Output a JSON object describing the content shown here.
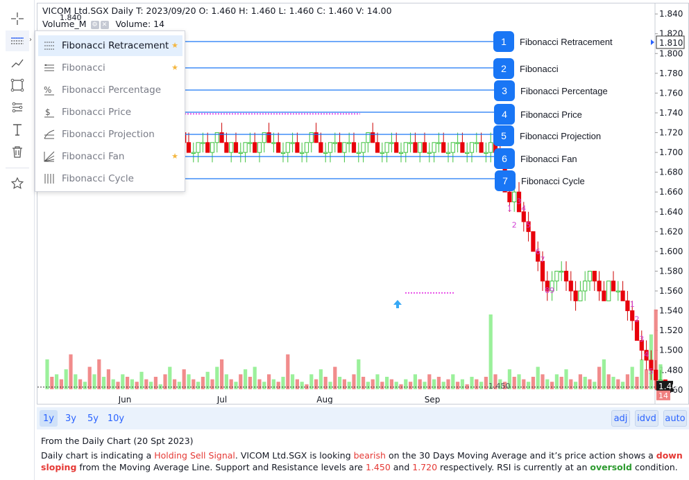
{
  "toolbar": {
    "tools": [
      "crosshair-icon",
      "fibonacci-icon",
      "trendline-icon",
      "rectangle-icon",
      "node-path-icon",
      "text-icon",
      "trash-icon",
      "star-icon"
    ]
  },
  "legend": {
    "symbol_line": "VICOM Ltd.SGX Daily   T: 2023/09/20  O: 1.460  H: 1.460  L: 1.460  C: 1.460  V: 14.00",
    "volume_label": "Volume_M",
    "volume_value": "Volume: 14",
    "high_marker": "1.840"
  },
  "menu": {
    "items": [
      {
        "label": "Fibonacci Retracement",
        "icon": "fibonacci-retracement-icon",
        "starred": true,
        "active": true
      },
      {
        "label": "Fibonacci",
        "icon": "fibonacci-icon",
        "starred": true,
        "active": false
      },
      {
        "label": "Fibonacci Percentage",
        "icon": "fibonacci-percentage-icon",
        "starred": false,
        "active": false
      },
      {
        "label": "Fibonacci Price",
        "icon": "fibonacci-price-icon",
        "starred": false,
        "active": false
      },
      {
        "label": "Fibonacci Projection",
        "icon": "fibonacci-projection-icon",
        "starred": false,
        "active": false
      },
      {
        "label": "Fibonacci Fan",
        "icon": "fibonacci-fan-icon",
        "starred": true,
        "active": false
      },
      {
        "label": "Fibonacci Cycle",
        "icon": "fibonacci-cycle-icon",
        "starred": false,
        "active": false
      }
    ]
  },
  "callouts": [
    {
      "number": "1",
      "label": "Fibonacci Retracement"
    },
    {
      "number": "2",
      "label": "Fibonacci"
    },
    {
      "number": "3",
      "label": "Fibonacci Percentage"
    },
    {
      "number": "4",
      "label": "Fibonacci Price"
    },
    {
      "number": "5",
      "label": "Fibonacci Projection"
    },
    {
      "number": "6",
      "label": "Fibonacci Fan"
    },
    {
      "number": "7",
      "label": "Fibonacci Cycle"
    }
  ],
  "range_buttons": [
    {
      "label": "1y",
      "active": true
    },
    {
      "label": "3y",
      "active": false
    },
    {
      "label": "5y",
      "active": false
    },
    {
      "label": "10y",
      "active": false
    }
  ],
  "right_buttons": [
    "adj",
    "idvd",
    "auto"
  ],
  "analysis": {
    "heading": "From the Daily Chart (20 Spt 2023)",
    "p1": "Daily chart is indicating a ",
    "signal": "Holding Sell Signal",
    "p2": ". VICOM Ltd.SGX is looking ",
    "bearish": "bearish",
    "p3": " on the 30 Days Moving Average and it’s price action shows a ",
    "down_sloping": "down sloping",
    "p4": " from the Moving Average Line. Support and Resistance levels are ",
    "support": "1.450",
    "p5": " and ",
    "resistance": "1.720",
    "p6": " respectively. RSI is currently at an ",
    "oversold": "oversold",
    "p7": " condition."
  },
  "chart_data": {
    "type": "candlestick",
    "y_ticks": [
      "1.840",
      "1.820",
      "1.800",
      "1.780",
      "1.760",
      "1.740",
      "1.720",
      "1.700",
      "1.680",
      "1.660",
      "1.640",
      "1.620",
      "1.600",
      "1.580",
      "1.560",
      "1.540",
      "1.520",
      "1.500",
      "1.480",
      "1.460"
    ],
    "ylim": [
      1.455,
      1.845
    ],
    "x_labels": [
      "Jun",
      "Jul",
      "Aug",
      "Sep"
    ],
    "price_marker": "1.810",
    "last_price": "1.46",
    "volume_badge": "14",
    "support_label": "1.450",
    "colors": {
      "up": "#90ee90",
      "down": "#e8000b",
      "vol_up": "#90ee90",
      "vol_down": "#f08080",
      "fib_line": "#1976f5",
      "count": "#d03fd3"
    },
    "td_counts": [
      {
        "label": "1",
        "day": 98,
        "price": 1.641
      },
      {
        "label": "2",
        "day": 99,
        "price": 1.624
      },
      {
        "label": "3",
        "day": 100,
        "price": 1.648
      },
      {
        "label": "4",
        "day": 101,
        "price": 1.641
      },
      {
        "label": "5",
        "day": 102,
        "price": 1.624
      },
      {
        "label": "6",
        "day": 104,
        "price": 1.597
      },
      {
        "label": "7",
        "day": 105,
        "price": 1.589
      },
      {
        "label": "8",
        "day": 106,
        "price": 1.558
      },
      {
        "label": "9",
        "day": 107,
        "price": 1.558
      },
      {
        "label": "1",
        "day": 124,
        "price": 1.544
      },
      {
        "label": "2",
        "day": 125,
        "price": 1.529
      },
      {
        "label": "3",
        "day": 126,
        "price": 1.509
      },
      {
        "label": "4",
        "day": 127,
        "price": 1.493
      },
      {
        "label": "5",
        "day": 128,
        "price": 1.476
      }
    ],
    "candles": [
      [
        1.72,
        1.74,
        1.71,
        1.73
      ],
      [
        1.73,
        1.74,
        1.72,
        1.72
      ],
      [
        1.72,
        1.73,
        1.71,
        1.72
      ],
      [
        1.72,
        1.73,
        1.71,
        1.71
      ],
      [
        1.71,
        1.72,
        1.7,
        1.72
      ],
      [
        1.72,
        1.73,
        1.71,
        1.72
      ],
      [
        1.72,
        1.73,
        1.71,
        1.71
      ],
      [
        1.71,
        1.72,
        1.7,
        1.71
      ],
      [
        1.71,
        1.72,
        1.7,
        1.72
      ],
      [
        1.72,
        1.73,
        1.71,
        1.71
      ],
      [
        1.71,
        1.72,
        1.7,
        1.71
      ],
      [
        1.71,
        1.72,
        1.7,
        1.7
      ],
      [
        1.7,
        1.71,
        1.69,
        1.71
      ],
      [
        1.71,
        1.72,
        1.7,
        1.72
      ],
      [
        1.72,
        1.73,
        1.71,
        1.71
      ],
      [
        1.71,
        1.72,
        1.7,
        1.7
      ],
      [
        1.7,
        1.71,
        1.69,
        1.71
      ],
      [
        1.71,
        1.72,
        1.7,
        1.72
      ],
      [
        1.72,
        1.73,
        1.71,
        1.71
      ],
      [
        1.71,
        1.72,
        1.7,
        1.7
      ],
      [
        1.7,
        1.71,
        1.69,
        1.7
      ],
      [
        1.7,
        1.71,
        1.69,
        1.71
      ],
      [
        1.71,
        1.72,
        1.7,
        1.72
      ],
      [
        1.72,
        1.73,
        1.71,
        1.71
      ],
      [
        1.71,
        1.72,
        1.7,
        1.71
      ],
      [
        1.71,
        1.72,
        1.7,
        1.7
      ],
      [
        1.7,
        1.71,
        1.69,
        1.7
      ],
      [
        1.7,
        1.72,
        1.69,
        1.71
      ],
      [
        1.71,
        1.72,
        1.7,
        1.72
      ],
      [
        1.72,
        1.73,
        1.71,
        1.71
      ],
      [
        1.71,
        1.72,
        1.7,
        1.7
      ],
      [
        1.7,
        1.71,
        1.69,
        1.7
      ],
      [
        1.7,
        1.71,
        1.69,
        1.71
      ],
      [
        1.71,
        1.72,
        1.7,
        1.71
      ],
      [
        1.71,
        1.72,
        1.7,
        1.7
      ],
      [
        1.7,
        1.71,
        1.69,
        1.71
      ],
      [
        1.71,
        1.72,
        1.7,
        1.72
      ],
      [
        1.72,
        1.73,
        1.71,
        1.71
      ],
      [
        1.71,
        1.72,
        1.7,
        1.7
      ],
      [
        1.7,
        1.71,
        1.69,
        1.71
      ],
      [
        1.71,
        1.72,
        1.7,
        1.7
      ],
      [
        1.7,
        1.71,
        1.69,
        1.7
      ],
      [
        1.7,
        1.71,
        1.69,
        1.71
      ],
      [
        1.71,
        1.72,
        1.7,
        1.71
      ],
      [
        1.71,
        1.72,
        1.7,
        1.7
      ],
      [
        1.7,
        1.71,
        1.69,
        1.71
      ],
      [
        1.71,
        1.72,
        1.7,
        1.72
      ],
      [
        1.72,
        1.73,
        1.71,
        1.71
      ],
      [
        1.71,
        1.72,
        1.7,
        1.71
      ],
      [
        1.71,
        1.72,
        1.7,
        1.7
      ],
      [
        1.7,
        1.71,
        1.69,
        1.7
      ],
      [
        1.7,
        1.71,
        1.69,
        1.71
      ],
      [
        1.71,
        1.72,
        1.7,
        1.71
      ],
      [
        1.71,
        1.72,
        1.7,
        1.7
      ],
      [
        1.7,
        1.71,
        1.69,
        1.7
      ],
      [
        1.7,
        1.71,
        1.69,
        1.71
      ],
      [
        1.71,
        1.72,
        1.7,
        1.72
      ],
      [
        1.72,
        1.73,
        1.71,
        1.71
      ],
      [
        1.71,
        1.72,
        1.7,
        1.7
      ],
      [
        1.7,
        1.71,
        1.69,
        1.7
      ],
      [
        1.7,
        1.71,
        1.69,
        1.71
      ],
      [
        1.71,
        1.72,
        1.7,
        1.71
      ],
      [
        1.71,
        1.72,
        1.7,
        1.7
      ],
      [
        1.7,
        1.71,
        1.69,
        1.71
      ],
      [
        1.71,
        1.72,
        1.7,
        1.71
      ],
      [
        1.71,
        1.72,
        1.7,
        1.7
      ],
      [
        1.7,
        1.71,
        1.69,
        1.7
      ],
      [
        1.7,
        1.71,
        1.69,
        1.71
      ],
      [
        1.71,
        1.72,
        1.7,
        1.72
      ],
      [
        1.72,
        1.73,
        1.71,
        1.71
      ],
      [
        1.71,
        1.72,
        1.7,
        1.7
      ],
      [
        1.7,
        1.71,
        1.69,
        1.7
      ],
      [
        1.7,
        1.71,
        1.69,
        1.71
      ],
      [
        1.71,
        1.72,
        1.7,
        1.71
      ],
      [
        1.71,
        1.72,
        1.7,
        1.7
      ],
      [
        1.7,
        1.71,
        1.69,
        1.7
      ],
      [
        1.7,
        1.71,
        1.69,
        1.71
      ],
      [
        1.71,
        1.72,
        1.7,
        1.71
      ],
      [
        1.71,
        1.72,
        1.7,
        1.7
      ],
      [
        1.7,
        1.71,
        1.69,
        1.71
      ],
      [
        1.71,
        1.72,
        1.7,
        1.7
      ],
      [
        1.7,
        1.71,
        1.69,
        1.7
      ],
      [
        1.7,
        1.71,
        1.69,
        1.71
      ],
      [
        1.71,
        1.72,
        1.7,
        1.71
      ],
      [
        1.71,
        1.72,
        1.7,
        1.7
      ],
      [
        1.7,
        1.71,
        1.69,
        1.7
      ],
      [
        1.7,
        1.71,
        1.69,
        1.71
      ],
      [
        1.71,
        1.72,
        1.7,
        1.71
      ],
      [
        1.71,
        1.72,
        1.7,
        1.7
      ],
      [
        1.7,
        1.71,
        1.69,
        1.7
      ],
      [
        1.7,
        1.71,
        1.69,
        1.71
      ],
      [
        1.71,
        1.72,
        1.7,
        1.71
      ],
      [
        1.71,
        1.72,
        1.7,
        1.7
      ],
      [
        1.7,
        1.71,
        1.69,
        1.7
      ],
      [
        1.7,
        1.72,
        1.69,
        1.71
      ],
      [
        1.71,
        1.72,
        1.7,
        1.7
      ],
      [
        1.7,
        1.72,
        1.69,
        1.69
      ],
      [
        1.69,
        1.69,
        1.66,
        1.66
      ],
      [
        1.66,
        1.67,
        1.64,
        1.65
      ],
      [
        1.65,
        1.67,
        1.64,
        1.66
      ],
      [
        1.66,
        1.67,
        1.64,
        1.64
      ],
      [
        1.64,
        1.65,
        1.62,
        1.63
      ],
      [
        1.63,
        1.64,
        1.61,
        1.62
      ],
      [
        1.62,
        1.62,
        1.6,
        1.6
      ],
      [
        1.6,
        1.61,
        1.58,
        1.59
      ],
      [
        1.59,
        1.6,
        1.56,
        1.57
      ],
      [
        1.57,
        1.58,
        1.55,
        1.56
      ],
      [
        1.56,
        1.58,
        1.55,
        1.57
      ],
      [
        1.57,
        1.58,
        1.56,
        1.58
      ],
      [
        1.58,
        1.59,
        1.57,
        1.58
      ],
      [
        1.58,
        1.59,
        1.56,
        1.57
      ],
      [
        1.57,
        1.58,
        1.55,
        1.56
      ],
      [
        1.56,
        1.57,
        1.54,
        1.55
      ],
      [
        1.55,
        1.57,
        1.55,
        1.56
      ],
      [
        1.56,
        1.58,
        1.55,
        1.57
      ],
      [
        1.57,
        1.58,
        1.56,
        1.58
      ],
      [
        1.58,
        1.58,
        1.56,
        1.57
      ],
      [
        1.57,
        1.58,
        1.55,
        1.56
      ],
      [
        1.56,
        1.57,
        1.55,
        1.55
      ],
      [
        1.55,
        1.57,
        1.55,
        1.57
      ],
      [
        1.57,
        1.58,
        1.56,
        1.56
      ],
      [
        1.56,
        1.57,
        1.55,
        1.56
      ],
      [
        1.56,
        1.57,
        1.55,
        1.55
      ],
      [
        1.55,
        1.56,
        1.53,
        1.54
      ],
      [
        1.54,
        1.55,
        1.52,
        1.53
      ],
      [
        1.53,
        1.53,
        1.51,
        1.51
      ],
      [
        1.51,
        1.52,
        1.49,
        1.5
      ],
      [
        1.5,
        1.51,
        1.48,
        1.49
      ],
      [
        1.49,
        1.5,
        1.47,
        1.48
      ],
      [
        1.48,
        1.49,
        1.46,
        1.47
      ],
      [
        1.47,
        1.48,
        1.46,
        1.47
      ],
      [
        1.47,
        1.47,
        1.46,
        1.46
      ]
    ],
    "volumes": [
      [
        12,
        1
      ],
      [
        5,
        0
      ],
      [
        6,
        1
      ],
      [
        4,
        0
      ],
      [
        8,
        1
      ],
      [
        14,
        0
      ],
      [
        6,
        1
      ],
      [
        4,
        0
      ],
      [
        3,
        1
      ],
      [
        9,
        0
      ],
      [
        6,
        1
      ],
      [
        12,
        0
      ],
      [
        5,
        1
      ],
      [
        8,
        0
      ],
      [
        4,
        1
      ],
      [
        3,
        0
      ],
      [
        6,
        1
      ],
      [
        5,
        0
      ],
      [
        4,
        1
      ],
      [
        3,
        0
      ],
      [
        7,
        1
      ],
      [
        4,
        0
      ],
      [
        3,
        1
      ],
      [
        5,
        0
      ],
      [
        2,
        1
      ],
      [
        6,
        0
      ],
      [
        9,
        1
      ],
      [
        4,
        0
      ],
      [
        3,
        1
      ],
      [
        8,
        0
      ],
      [
        6,
        1
      ],
      [
        4,
        0
      ],
      [
        3,
        1
      ],
      [
        5,
        0
      ],
      [
        7,
        1
      ],
      [
        4,
        0
      ],
      [
        9,
        1
      ],
      [
        12,
        0
      ],
      [
        6,
        1
      ],
      [
        4,
        0
      ],
      [
        3,
        1
      ],
      [
        6,
        0
      ],
      [
        8,
        1
      ],
      [
        5,
        0
      ],
      [
        9,
        1
      ],
      [
        4,
        0
      ],
      [
        3,
        1
      ],
      [
        6,
        0
      ],
      [
        4,
        1
      ],
      [
        3,
        0
      ],
      [
        5,
        1
      ],
      [
        14,
        0
      ],
      [
        6,
        1
      ],
      [
        4,
        0
      ],
      [
        3,
        1
      ],
      [
        2,
        0
      ],
      [
        6,
        1
      ],
      [
        4,
        0
      ],
      [
        8,
        1
      ],
      [
        5,
        0
      ],
      [
        3,
        1
      ],
      [
        9,
        0
      ],
      [
        5,
        1
      ],
      [
        4,
        0
      ],
      [
        3,
        1
      ],
      [
        6,
        0
      ],
      [
        12,
        1
      ],
      [
        5,
        0
      ],
      [
        3,
        1
      ],
      [
        4,
        0
      ],
      [
        6,
        1
      ],
      [
        3,
        0
      ],
      [
        5,
        1
      ],
      [
        4,
        0
      ],
      [
        3,
        1
      ],
      [
        2,
        0
      ],
      [
        4,
        1
      ],
      [
        3,
        0
      ],
      [
        6,
        1
      ],
      [
        4,
        0
      ],
      [
        3,
        1
      ],
      [
        6,
        0
      ],
      [
        4,
        1
      ],
      [
        5,
        0
      ],
      [
        3,
        1
      ],
      [
        4,
        0
      ],
      [
        6,
        1
      ],
      [
        3,
        0
      ],
      [
        4,
        1
      ],
      [
        2,
        0
      ],
      [
        5,
        1
      ],
      [
        4,
        0
      ],
      [
        3,
        1
      ],
      [
        5,
        0
      ],
      [
        30,
        1
      ],
      [
        6,
        0
      ],
      [
        4,
        1
      ],
      [
        3,
        0
      ],
      [
        8,
        1
      ],
      [
        5,
        0
      ],
      [
        6,
        1
      ],
      [
        4,
        0
      ],
      [
        3,
        1
      ],
      [
        5,
        0
      ],
      [
        9,
        1
      ],
      [
        6,
        0
      ],
      [
        4,
        1
      ],
      [
        3,
        0
      ],
      [
        6,
        1
      ],
      [
        5,
        0
      ],
      [
        8,
        1
      ],
      [
        4,
        0
      ],
      [
        3,
        1
      ],
      [
        6,
        0
      ],
      [
        5,
        1
      ],
      [
        4,
        0
      ],
      [
        3,
        1
      ],
      [
        9,
        0
      ],
      [
        12,
        1
      ],
      [
        6,
        0
      ],
      [
        5,
        1
      ],
      [
        4,
        0
      ],
      [
        3,
        1
      ],
      [
        6,
        0
      ],
      [
        9,
        1
      ],
      [
        5,
        0
      ],
      [
        12,
        1
      ],
      [
        8,
        0
      ],
      [
        22,
        1
      ],
      [
        32,
        0
      ],
      [
        10,
        1
      ],
      [
        4,
        0
      ],
      [
        2,
        1
      ]
    ]
  }
}
